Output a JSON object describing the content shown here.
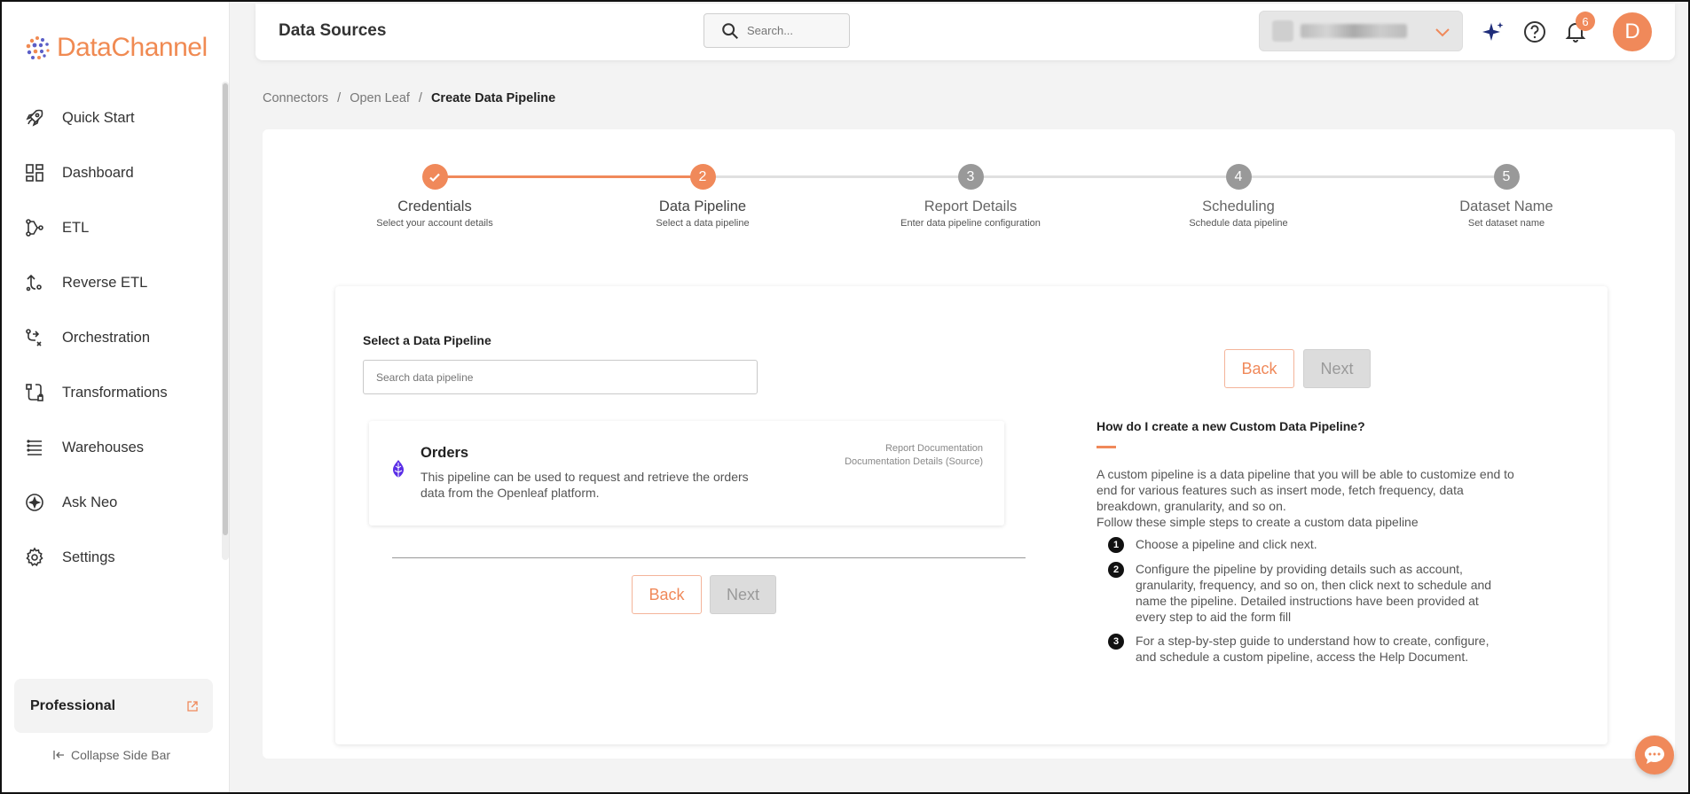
{
  "brand": {
    "name_part1": "Data",
    "name_part2": "Channel"
  },
  "colors": {
    "accent": "#f0895a",
    "brand_blue": "#5b5fc7",
    "step_inactive": "#999999"
  },
  "sidebar": {
    "items": [
      {
        "label": "Quick Start",
        "icon": "rocket-icon"
      },
      {
        "label": "Dashboard",
        "icon": "dashboard-icon"
      },
      {
        "label": "ETL",
        "icon": "etl-icon"
      },
      {
        "label": "Reverse ETL",
        "icon": "reverse-etl-icon"
      },
      {
        "label": "Orchestration",
        "icon": "orchestration-icon"
      },
      {
        "label": "Transformations",
        "icon": "transformations-icon"
      },
      {
        "label": "Warehouses",
        "icon": "warehouses-icon"
      },
      {
        "label": "Ask Neo",
        "icon": "ask-neo-icon"
      },
      {
        "label": "Settings",
        "icon": "gear-icon"
      }
    ],
    "plan": "Professional",
    "collapse_label": "Collapse Side Bar"
  },
  "header": {
    "title": "Data Sources",
    "search_placeholder": "Search...",
    "notifications_count": "6",
    "avatar_initial": "D"
  },
  "breadcrumb": {
    "items": [
      "Connectors",
      "Open Leaf"
    ],
    "current": "Create Data Pipeline"
  },
  "steps": [
    {
      "num": "",
      "title": "Credentials",
      "subtitle": "Select your account details",
      "state": "done"
    },
    {
      "num": "2",
      "title": "Data Pipeline",
      "subtitle": "Select a data pipeline",
      "state": "active"
    },
    {
      "num": "3",
      "title": "Report Details",
      "subtitle": "Enter data pipeline configuration",
      "state": "pending"
    },
    {
      "num": "4",
      "title": "Scheduling",
      "subtitle": "Schedule data pipeline",
      "state": "pending"
    },
    {
      "num": "5",
      "title": "Dataset Name",
      "subtitle": "Set dataset name",
      "state": "pending"
    }
  ],
  "form": {
    "label": "Select a Data Pipeline",
    "search_placeholder": "Search data pipeline",
    "back_label": "Back",
    "next_label": "Next"
  },
  "pipeline": {
    "name": "Orders",
    "description": "This pipeline can be used to request and retrieve the orders data from the Openleaf platform.",
    "link1": "Report Documentation",
    "link2": "Documentation Details (Source)"
  },
  "help": {
    "title": "How do I create a new Custom Data Pipeline?",
    "intro": "A custom pipeline is a data pipeline that you will be able to customize end to end for various features such as insert mode, fetch frequency, data breakdown, granularity, and so on.",
    "intro2": "Follow these simple steps to create a custom data pipeline",
    "steps": [
      {
        "num": "1",
        "text": "Choose a pipeline and click next."
      },
      {
        "num": "2",
        "text": "Configure the pipeline by providing details such as account, granularity, frequency, and so on, then click next to schedule and name the pipeline. Detailed instructions have been provided at every step to aid the form fill"
      },
      {
        "num": "3",
        "text": "For a step-by-step guide to understand how to create, configure, and schedule a custom pipeline, access the Help Document."
      }
    ]
  }
}
